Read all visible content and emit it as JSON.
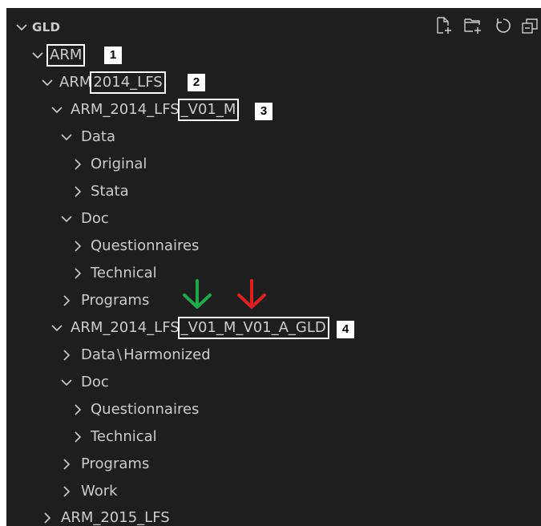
{
  "explorer": {
    "root_label": "GLD",
    "toolbar": [
      {
        "icon": "new-file-icon"
      },
      {
        "icon": "new-folder-icon"
      },
      {
        "icon": "refresh-icon"
      },
      {
        "icon": "collapse-all-icon"
      }
    ]
  },
  "tree": {
    "arm": "ARM",
    "arm_2014_prefix": "ARM",
    "arm_2014_suffix": "2014_LFS",
    "v01_prefix": "ARM_2014_LFS",
    "v01_suffix": "_V01_M",
    "data": "Data",
    "original": "Original",
    "stata": "Stata",
    "doc": "Doc",
    "questionnaires": "Questionnaires",
    "technical": "Technical",
    "programs": "Programs",
    "gld_prefix": "ARM_2014_LFS",
    "gld_suffix": "_V01_M_V01_A_GLD",
    "data_harm_a": "Data",
    "data_harm_sep": "\\",
    "data_harm_b": "Harmonized",
    "doc2": "Doc",
    "questionnaires2": "Questionnaires",
    "technical2": "Technical",
    "programs2": "Programs",
    "work": "Work",
    "arm_2015": "ARM_2015_LFS"
  },
  "annotations": {
    "badge1": "1",
    "badge2": "2",
    "badge3": "3",
    "badge4": "4",
    "arrow_green": "#1ea84a",
    "arrow_red": "#e02020"
  },
  "colors": {
    "background": "#1e1e1e",
    "text": "#cccccc",
    "box_outline": "#ffffff"
  }
}
